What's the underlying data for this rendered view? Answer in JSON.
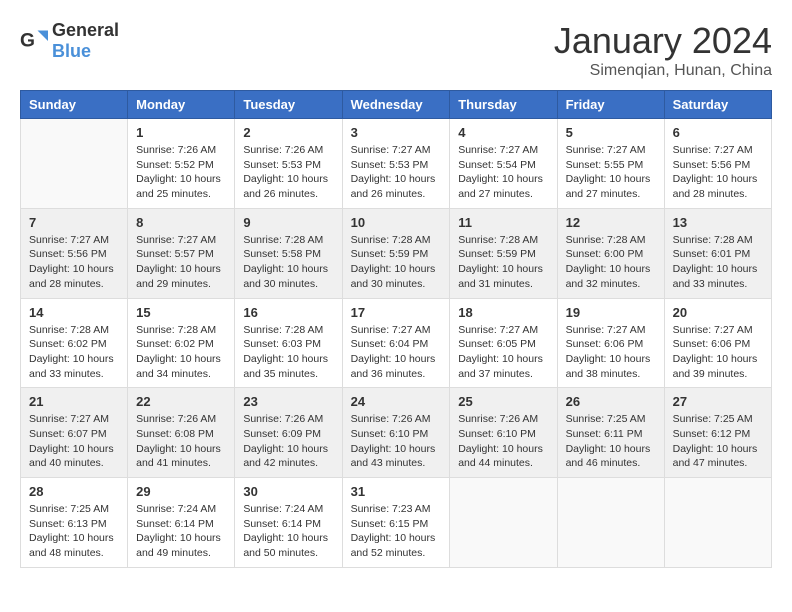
{
  "header": {
    "logo": {
      "general": "General",
      "blue": "Blue"
    },
    "title": "January 2024",
    "subtitle": "Simenqian, Hunan, China"
  },
  "days": [
    "Sunday",
    "Monday",
    "Tuesday",
    "Wednesday",
    "Thursday",
    "Friday",
    "Saturday"
  ],
  "weeks": [
    [
      {
        "day": "",
        "sunrise": "",
        "sunset": "",
        "daylight": ""
      },
      {
        "day": "1",
        "sunrise": "Sunrise: 7:26 AM",
        "sunset": "Sunset: 5:52 PM",
        "daylight": "Daylight: 10 hours and 25 minutes."
      },
      {
        "day": "2",
        "sunrise": "Sunrise: 7:26 AM",
        "sunset": "Sunset: 5:53 PM",
        "daylight": "Daylight: 10 hours and 26 minutes."
      },
      {
        "day": "3",
        "sunrise": "Sunrise: 7:27 AM",
        "sunset": "Sunset: 5:53 PM",
        "daylight": "Daylight: 10 hours and 26 minutes."
      },
      {
        "day": "4",
        "sunrise": "Sunrise: 7:27 AM",
        "sunset": "Sunset: 5:54 PM",
        "daylight": "Daylight: 10 hours and 27 minutes."
      },
      {
        "day": "5",
        "sunrise": "Sunrise: 7:27 AM",
        "sunset": "Sunset: 5:55 PM",
        "daylight": "Daylight: 10 hours and 27 minutes."
      },
      {
        "day": "6",
        "sunrise": "Sunrise: 7:27 AM",
        "sunset": "Sunset: 5:56 PM",
        "daylight": "Daylight: 10 hours and 28 minutes."
      }
    ],
    [
      {
        "day": "7",
        "sunrise": "Sunrise: 7:27 AM",
        "sunset": "Sunset: 5:56 PM",
        "daylight": "Daylight: 10 hours and 28 minutes."
      },
      {
        "day": "8",
        "sunrise": "Sunrise: 7:27 AM",
        "sunset": "Sunset: 5:57 PM",
        "daylight": "Daylight: 10 hours and 29 minutes."
      },
      {
        "day": "9",
        "sunrise": "Sunrise: 7:28 AM",
        "sunset": "Sunset: 5:58 PM",
        "daylight": "Daylight: 10 hours and 30 minutes."
      },
      {
        "day": "10",
        "sunrise": "Sunrise: 7:28 AM",
        "sunset": "Sunset: 5:59 PM",
        "daylight": "Daylight: 10 hours and 30 minutes."
      },
      {
        "day": "11",
        "sunrise": "Sunrise: 7:28 AM",
        "sunset": "Sunset: 5:59 PM",
        "daylight": "Daylight: 10 hours and 31 minutes."
      },
      {
        "day": "12",
        "sunrise": "Sunrise: 7:28 AM",
        "sunset": "Sunset: 6:00 PM",
        "daylight": "Daylight: 10 hours and 32 minutes."
      },
      {
        "day": "13",
        "sunrise": "Sunrise: 7:28 AM",
        "sunset": "Sunset: 6:01 PM",
        "daylight": "Daylight: 10 hours and 33 minutes."
      }
    ],
    [
      {
        "day": "14",
        "sunrise": "Sunrise: 7:28 AM",
        "sunset": "Sunset: 6:02 PM",
        "daylight": "Daylight: 10 hours and 33 minutes."
      },
      {
        "day": "15",
        "sunrise": "Sunrise: 7:28 AM",
        "sunset": "Sunset: 6:02 PM",
        "daylight": "Daylight: 10 hours and 34 minutes."
      },
      {
        "day": "16",
        "sunrise": "Sunrise: 7:28 AM",
        "sunset": "Sunset: 6:03 PM",
        "daylight": "Daylight: 10 hours and 35 minutes."
      },
      {
        "day": "17",
        "sunrise": "Sunrise: 7:27 AM",
        "sunset": "Sunset: 6:04 PM",
        "daylight": "Daylight: 10 hours and 36 minutes."
      },
      {
        "day": "18",
        "sunrise": "Sunrise: 7:27 AM",
        "sunset": "Sunset: 6:05 PM",
        "daylight": "Daylight: 10 hours and 37 minutes."
      },
      {
        "day": "19",
        "sunrise": "Sunrise: 7:27 AM",
        "sunset": "Sunset: 6:06 PM",
        "daylight": "Daylight: 10 hours and 38 minutes."
      },
      {
        "day": "20",
        "sunrise": "Sunrise: 7:27 AM",
        "sunset": "Sunset: 6:06 PM",
        "daylight": "Daylight: 10 hours and 39 minutes."
      }
    ],
    [
      {
        "day": "21",
        "sunrise": "Sunrise: 7:27 AM",
        "sunset": "Sunset: 6:07 PM",
        "daylight": "Daylight: 10 hours and 40 minutes."
      },
      {
        "day": "22",
        "sunrise": "Sunrise: 7:26 AM",
        "sunset": "Sunset: 6:08 PM",
        "daylight": "Daylight: 10 hours and 41 minutes."
      },
      {
        "day": "23",
        "sunrise": "Sunrise: 7:26 AM",
        "sunset": "Sunset: 6:09 PM",
        "daylight": "Daylight: 10 hours and 42 minutes."
      },
      {
        "day": "24",
        "sunrise": "Sunrise: 7:26 AM",
        "sunset": "Sunset: 6:10 PM",
        "daylight": "Daylight: 10 hours and 43 minutes."
      },
      {
        "day": "25",
        "sunrise": "Sunrise: 7:26 AM",
        "sunset": "Sunset: 6:10 PM",
        "daylight": "Daylight: 10 hours and 44 minutes."
      },
      {
        "day": "26",
        "sunrise": "Sunrise: 7:25 AM",
        "sunset": "Sunset: 6:11 PM",
        "daylight": "Daylight: 10 hours and 46 minutes."
      },
      {
        "day": "27",
        "sunrise": "Sunrise: 7:25 AM",
        "sunset": "Sunset: 6:12 PM",
        "daylight": "Daylight: 10 hours and 47 minutes."
      }
    ],
    [
      {
        "day": "28",
        "sunrise": "Sunrise: 7:25 AM",
        "sunset": "Sunset: 6:13 PM",
        "daylight": "Daylight: 10 hours and 48 minutes."
      },
      {
        "day": "29",
        "sunrise": "Sunrise: 7:24 AM",
        "sunset": "Sunset: 6:14 PM",
        "daylight": "Daylight: 10 hours and 49 minutes."
      },
      {
        "day": "30",
        "sunrise": "Sunrise: 7:24 AM",
        "sunset": "Sunset: 6:14 PM",
        "daylight": "Daylight: 10 hours and 50 minutes."
      },
      {
        "day": "31",
        "sunrise": "Sunrise: 7:23 AM",
        "sunset": "Sunset: 6:15 PM",
        "daylight": "Daylight: 10 hours and 52 minutes."
      },
      {
        "day": "",
        "sunrise": "",
        "sunset": "",
        "daylight": ""
      },
      {
        "day": "",
        "sunrise": "",
        "sunset": "",
        "daylight": ""
      },
      {
        "day": "",
        "sunrise": "",
        "sunset": "",
        "daylight": ""
      }
    ]
  ]
}
